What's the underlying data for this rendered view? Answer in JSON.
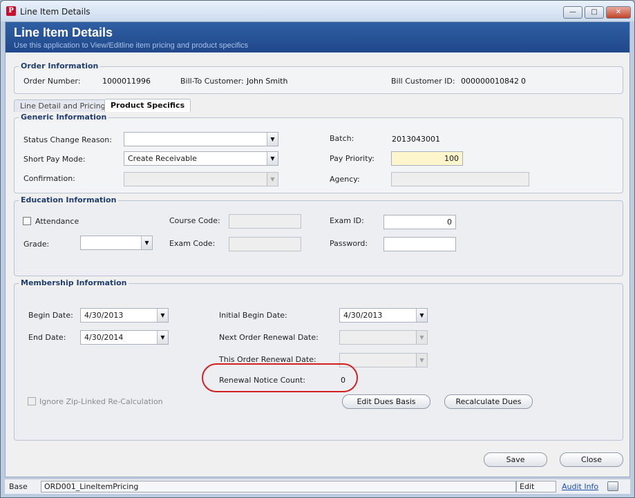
{
  "window": {
    "title": "Line Item Details",
    "controls": {
      "minimize": "—",
      "maximize": "□",
      "close": "✕"
    }
  },
  "banner": {
    "title": "Line Item Details",
    "subtitle": "Use this application to View/Editline item pricing and product specifics"
  },
  "order_info": {
    "title": "Order Information",
    "order_number_label": "Order Number:",
    "order_number": "1000011996",
    "bill_to_label": "Bill-To Customer:",
    "bill_to": "John Smith",
    "bill_id_label": "Bill Customer ID:",
    "bill_id": "000000010842",
    "bill_id_suffix": "0"
  },
  "tabs": [
    {
      "label": "Line Detail and Pricing"
    },
    {
      "label": "Product Specifics"
    }
  ],
  "generic": {
    "title": "Generic Information",
    "status_reason_label": "Status Change Reason:",
    "status_reason": "",
    "short_pay_label": "Short Pay Mode:",
    "short_pay": "Create Receivable",
    "confirmation_label": "Confirmation:",
    "confirmation": "",
    "batch_label": "Batch:",
    "batch": "2013043001",
    "pay_priority_label": "Pay Priority:",
    "pay_priority": "100",
    "agency_label": "Agency:",
    "agency": ""
  },
  "education": {
    "title": "Education Information",
    "attendance_label": "Attendance",
    "grade_label": "Grade:",
    "grade": "",
    "course_code_label": "Course Code:",
    "course_code": "",
    "exam_code_label": "Exam Code:",
    "exam_code": "",
    "exam_id_label": "Exam ID:",
    "exam_id": "0",
    "password_label": "Password:",
    "password": ""
  },
  "membership": {
    "title": "Membership Information",
    "begin_date_label": "Begin Date:",
    "begin_date": "4/30/2013",
    "end_date_label": "End Date:",
    "end_date": "4/30/2014",
    "initial_begin_label": "Initial Begin Date:",
    "initial_begin": "4/30/2013",
    "next_renewal_label": "Next Order Renewal Date:",
    "next_renewal": "",
    "this_renewal_label": "This Order Renewal Date:",
    "this_renewal": "",
    "renewal_count_label": "Renewal Notice Count:",
    "renewal_count": "0",
    "ignore_zip_label": "Ignore Zip-Linked Re-Calculation",
    "edit_dues_label": "Edit Dues Basis",
    "recalc_dues_label": "Recalculate Dues"
  },
  "actions": {
    "save_label": "Save",
    "close_label": "Close"
  },
  "statusbar": {
    "base": "Base",
    "form_id": "ORD001_LineItemPricing",
    "mode": "Edit",
    "audit_label": "Audit Info"
  },
  "icons": {
    "dropdown": "▼"
  },
  "colors": {
    "banner": "#20488a",
    "highlight_field": "#fdf6cc",
    "callout": "#d31f1f",
    "link": "#1b4fb4"
  }
}
